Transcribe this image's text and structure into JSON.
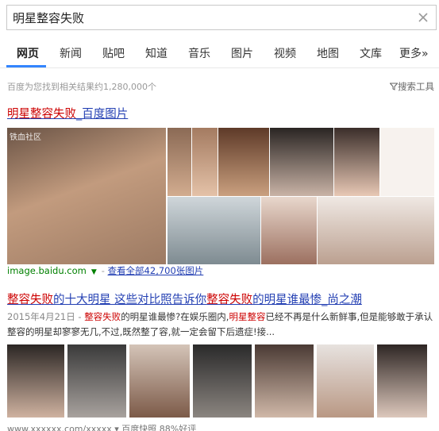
{
  "search": {
    "query": "明星整容失败"
  },
  "tabs": [
    {
      "label": "网页"
    },
    {
      "label": "新闻"
    },
    {
      "label": "贴吧"
    },
    {
      "label": "知道"
    },
    {
      "label": "音乐"
    },
    {
      "label": "图片"
    },
    {
      "label": "视频"
    },
    {
      "label": "地图"
    },
    {
      "label": "文库"
    },
    {
      "label": "更多»"
    }
  ],
  "results_info": {
    "count_text": "百度为您找到相关结果约1,280,000个",
    "tools_label": "搜索工具"
  },
  "result1": {
    "title_highlight": "明星整容失败",
    "title_rest": "_百度图片",
    "source_url": "image.baidu.com",
    "view_all": "查看全部42,700张图片",
    "watermark": "铁血社区"
  },
  "result2": {
    "title_part1": "整容失败",
    "title_part2": "的十大明星 这些对比照告诉你",
    "title_part3": "整容失败",
    "title_part4": "的明星谁最惨_尚之潮",
    "date": "2015年4月21日 - ",
    "snippet_hl1": "整容失败",
    "snippet_txt1": "的明星谁最惨?在娱乐圈内,",
    "snippet_hl2": "明星整容",
    "snippet_txt2": "已经不再是什么新鲜事,但是能够敢于承认整容的明星却寥寥无几,不过,既然整了容,就一定会留下后遗症!接..."
  },
  "bottom": {
    "text": "www.xxxxxx.com/xxxxx  ▾  百度快照  88%好评"
  },
  "colors": {
    "link": "#2440b3",
    "highlight": "#cc0000",
    "url_green": "#008000",
    "accent": "#3385ff"
  }
}
